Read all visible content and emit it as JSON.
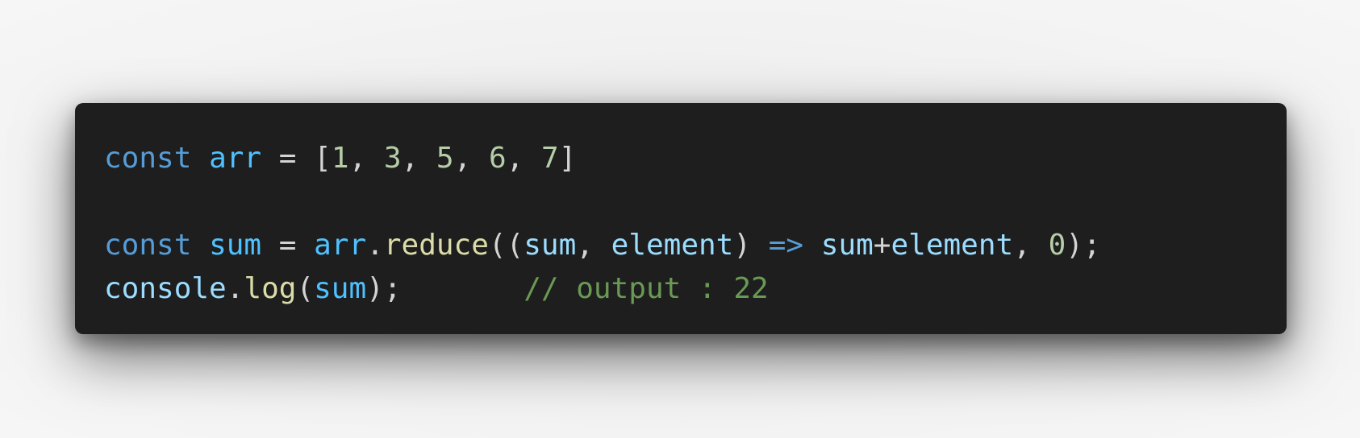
{
  "code": {
    "line1": {
      "kw": "const",
      "name": "arr",
      "assign": " = ",
      "open": "[",
      "n1": "1",
      "n2": "3",
      "n3": "5",
      "n4": "6",
      "n5": "7",
      "sep": ", ",
      "close": "]"
    },
    "line3": {
      "kw": "const",
      "name": "sum",
      "assign": " = ",
      "obj": "arr",
      "dot": ".",
      "method": "reduce",
      "open_parens": "((",
      "param1": "sum",
      "comma": ", ",
      "param2": "element",
      "close_param": ") ",
      "arrow": "=>",
      "body_a": "sum",
      "plus": "+",
      "body_b": "element",
      "comma2": ", ",
      "init": "0",
      "end": ");"
    },
    "line4": {
      "obj": "console",
      "dot": ".",
      "method": "log",
      "open": "(",
      "arg": "sum",
      "end": ");",
      "spacer": "       ",
      "comment": "// output : 22"
    }
  },
  "colors": {
    "background": "#1e1e1e",
    "keyword": "#569cd6",
    "variable": "#9cdcfe",
    "constant": "#4fc1ff",
    "number": "#b5cea8",
    "function": "#dcdcaa",
    "comment": "#6a9955",
    "text": "#d4d4d4"
  }
}
